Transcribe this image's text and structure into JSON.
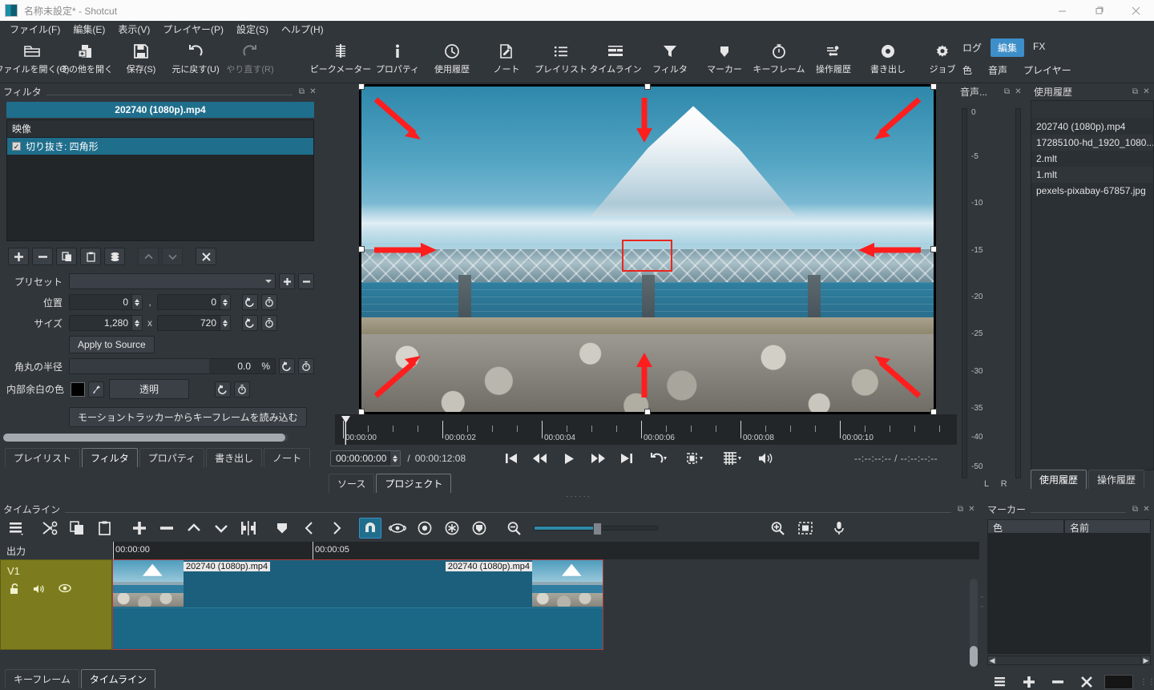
{
  "window": {
    "title": "名称未設定* - Shotcut",
    "minimize": "−",
    "maximize": "❐",
    "close": "✕"
  },
  "menubar": [
    {
      "label": "ファイル(F)"
    },
    {
      "label": "編集(E)"
    },
    {
      "label": "表示(V)"
    },
    {
      "label": "プレイヤー(P)"
    },
    {
      "label": "設定(S)"
    },
    {
      "label": "ヘルプ(H)"
    }
  ],
  "toolbar": [
    {
      "label": "ファイルを開く(O)",
      "icon": "open-file-icon",
      "disabled": false
    },
    {
      "label": "その他を開く",
      "icon": "open-other-icon",
      "disabled": false
    },
    {
      "label": "保存(S)",
      "icon": "save-icon",
      "disabled": false
    },
    {
      "label": "元に戻す(U)",
      "icon": "undo-icon",
      "disabled": false
    },
    {
      "label": "やり直す(R)",
      "icon": "redo-icon",
      "disabled": true
    },
    {
      "label": "ピークメーター",
      "icon": "peak-meter-icon",
      "disabled": false
    },
    {
      "label": "プロパティ",
      "icon": "properties-icon",
      "disabled": false
    },
    {
      "label": "使用履歴",
      "icon": "recent-icon",
      "disabled": false
    },
    {
      "label": "ノート",
      "icon": "notes-icon",
      "disabled": false
    },
    {
      "label": "プレイリスト",
      "icon": "playlist-icon",
      "disabled": false
    },
    {
      "label": "タイムライン",
      "icon": "timeline-icon",
      "disabled": false
    },
    {
      "label": "フィルタ",
      "icon": "filters-icon",
      "disabled": false
    },
    {
      "label": "マーカー",
      "icon": "marker-icon",
      "disabled": false
    },
    {
      "label": "キーフレーム",
      "icon": "keyframes-icon",
      "disabled": false
    },
    {
      "label": "操作履歴",
      "icon": "history-icon",
      "disabled": false
    },
    {
      "label": "書き出し",
      "icon": "export-icon",
      "disabled": false
    },
    {
      "label": "ジョブ",
      "icon": "jobs-icon",
      "disabled": false
    }
  ],
  "layout_buttons": {
    "row1": [
      {
        "label": "ログ",
        "active": false
      },
      {
        "label": "編集",
        "active": true
      },
      {
        "label": "FX",
        "active": false
      }
    ],
    "row2": [
      {
        "label": "色",
        "active": false
      },
      {
        "label": "音声",
        "active": false
      },
      {
        "label": "プレイヤー",
        "active": false
      }
    ]
  },
  "filters_panel": {
    "title": "フィルタ",
    "clip_name": "202740 (1080p).mp4",
    "group_label": "映像",
    "active_filter": {
      "name": "切り抜き: 四角形",
      "checked": true,
      "check_glyph": "✓"
    },
    "actions": [
      {
        "name": "add-filter-button",
        "glyph": "＋",
        "disabled": false
      },
      {
        "name": "remove-filter-button",
        "glyph": "−",
        "disabled": false
      },
      {
        "name": "copy-filter-button",
        "glyph": "⧉",
        "disabled": false
      },
      {
        "name": "paste-filter-button",
        "glyph": "📋",
        "disabled": false
      },
      {
        "name": "save-filter-set-button",
        "glyph": "≡",
        "disabled": false
      },
      {
        "name": "move-up-button",
        "glyph": "︿",
        "disabled": true
      },
      {
        "name": "move-down-button",
        "glyph": "﹀",
        "disabled": true
      },
      {
        "name": "deselect-button",
        "glyph": "✕",
        "disabled": false
      }
    ],
    "params": {
      "preset_label": "プリセット",
      "preset_value": "",
      "position_label": "位置",
      "position_x": "0",
      "position_y": "0",
      "position_separator": ",",
      "size_label": "サイズ",
      "size_w": "1,280",
      "size_h": "720",
      "size_separator": "x",
      "apply_to_source": "Apply to Source",
      "corner_radius_label": "角丸の半径",
      "corner_radius_value": "0.0",
      "corner_radius_unit": "%",
      "padding_color_label": "内部余白の色",
      "padding_transparent": "透明",
      "padding_color_hex": "#000000",
      "motion_tracker_button": "モーショントラッカーからキーフレームを読み込む",
      "reset_glyph": "↺",
      "keyframe_glyph": "⏱"
    },
    "tabs": [
      {
        "label": "プレイリスト",
        "active": false
      },
      {
        "label": "フィルタ",
        "active": true
      },
      {
        "label": "プロパティ",
        "active": false
      },
      {
        "label": "書き出し",
        "active": false
      },
      {
        "label": "ノート",
        "active": false
      }
    ]
  },
  "player": {
    "current_timecode": "00:00:00:00",
    "total_duration": "00:00:12:08",
    "duration_separator": "/",
    "in_out": "--:--:--:--  /  --:--:--:--",
    "ruler_labels": [
      "00:00:00",
      "00:00:02",
      "00:00:04",
      "00:00:06",
      "00:00:08",
      "00:00:10"
    ],
    "transport": [
      {
        "name": "skip-to-start-button",
        "glyph": "⏮"
      },
      {
        "name": "rewind-button",
        "glyph": "⏪"
      },
      {
        "name": "play-button",
        "glyph": "▶"
      },
      {
        "name": "fast-forward-button",
        "glyph": "⏩"
      },
      {
        "name": "skip-to-end-button",
        "glyph": "⏭"
      },
      {
        "name": "loop-button",
        "glyph": "↺"
      },
      {
        "name": "zoom-fit-button",
        "glyph": "▣"
      },
      {
        "name": "grid-button",
        "glyph": "▦"
      },
      {
        "name": "volume-button",
        "glyph": "🔊"
      }
    ],
    "tabs": [
      {
        "label": "ソース",
        "active": false
      },
      {
        "label": "プロジェクト",
        "active": true
      }
    ],
    "overlay": {
      "crop_rect_color": "#e8271f",
      "arrow_color": "#ff1e1e",
      "handle_color": "#ffffff"
    }
  },
  "audio_meter": {
    "title": "音声...",
    "scale": [
      "0",
      "-5",
      "-10",
      "-15",
      "-20",
      "-25",
      "-30",
      "-35",
      "-40",
      "-50"
    ],
    "channels": "L  R"
  },
  "recent_panel": {
    "title": "使用履歴",
    "items": [
      {
        "label": "",
        "header": true
      },
      {
        "label": "202740 (1080p).mp4"
      },
      {
        "label": "17285100-hd_1920_1080..."
      },
      {
        "label": "2.mlt"
      },
      {
        "label": "1.mlt"
      },
      {
        "label": "pexels-pixabay-67857.jpg"
      }
    ],
    "tabs": [
      {
        "label": "使用履歴",
        "active": true
      },
      {
        "label": "操作履歴",
        "active": false
      }
    ]
  },
  "timeline": {
    "title": "タイムライン",
    "tools": [
      {
        "name": "timeline-menu-button",
        "glyph": "≡"
      },
      {
        "name": "cut-button",
        "glyph": "✂"
      },
      {
        "name": "copy-button",
        "glyph": "⧉"
      },
      {
        "name": "paste-button",
        "glyph": "📋"
      },
      {
        "name": "append-button",
        "glyph": "＋"
      },
      {
        "name": "ripple-delete-button",
        "glyph": "−"
      },
      {
        "name": "lift-button",
        "glyph": "︿"
      },
      {
        "name": "overwrite-button",
        "glyph": "﹀"
      },
      {
        "name": "split-button",
        "glyph": "]["
      },
      {
        "name": "marker-button",
        "glyph": "▼"
      },
      {
        "name": "previous-marker-button",
        "glyph": "❮"
      },
      {
        "name": "next-marker-button",
        "glyph": "❯"
      },
      {
        "name": "snap-button",
        "glyph": "🧲",
        "active": true
      },
      {
        "name": "scrub-while-dragging-button",
        "glyph": "👁"
      },
      {
        "name": "ripple-button",
        "glyph": "◎"
      },
      {
        "name": "ripple-all-tracks-button",
        "glyph": "✳"
      },
      {
        "name": "ripple-markers-button",
        "glyph": "🛡"
      },
      {
        "name": "zoom-out-button",
        "glyph": "🔍"
      },
      {
        "name": "zoom-in-button",
        "glyph": "🔍"
      },
      {
        "name": "zoom-fit-button",
        "glyph": "▣"
      },
      {
        "name": "record-audio-button",
        "glyph": "🎤"
      }
    ],
    "output_label": "出力",
    "track": {
      "name": "V1",
      "lock_icon": "unlock-icon",
      "mute_icon": "speaker-icon",
      "hide_icon": "eye-icon"
    },
    "ruler_labels": [
      "00:00:00",
      "00:00:05"
    ],
    "clip_name": "202740 (1080p).mp4",
    "tabs": [
      {
        "label": "キーフレーム",
        "active": false
      },
      {
        "label": "タイムライン",
        "active": true
      }
    ]
  },
  "markers_panel": {
    "title": "マーカー",
    "columns": [
      "色",
      "名前"
    ],
    "rows": [],
    "buttons": [
      {
        "name": "markers-menu-button",
        "glyph": "≡"
      },
      {
        "name": "add-marker-button",
        "glyph": "＋"
      },
      {
        "name": "remove-marker-button",
        "glyph": "−"
      },
      {
        "name": "clear-markers-button",
        "glyph": "✕"
      }
    ],
    "swatch_hex": "#151515"
  },
  "colors": {
    "accent": "#3d8ec9",
    "panel_bg": "#31363b",
    "clip_blue": "#1c5f7c",
    "track_head": "#7c7c1e",
    "highlight": "#1f6e8c",
    "arrow_red": "#ff1e1e"
  }
}
